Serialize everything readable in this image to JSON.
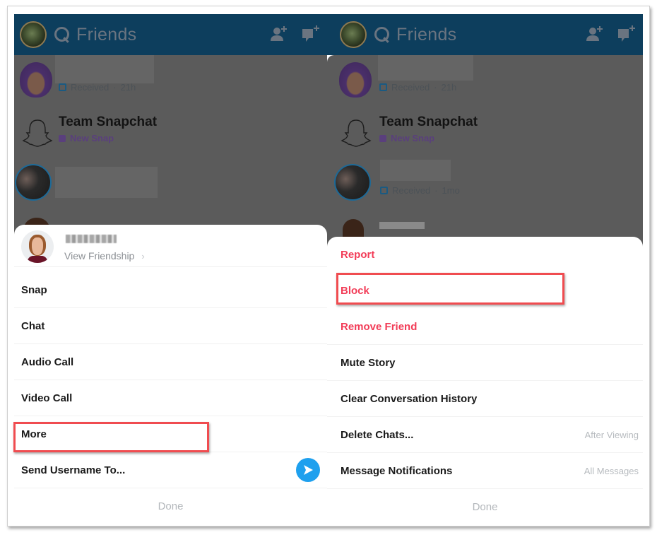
{
  "left_panel": {
    "header": {
      "title": "Friends",
      "icons": [
        "bitmoji-avatar",
        "search-icon",
        "add-friend-icon",
        "new-chat-icon"
      ]
    },
    "friends_list": [
      {
        "name": "",
        "status_icon": "chat-outline-icon",
        "status": "Received",
        "time": "21h"
      },
      {
        "name": "Team Snapchat",
        "status_icon": "snap-square-icon",
        "status": "New Snap"
      },
      {
        "name": "",
        "status_icon": "chat-outline-icon",
        "status": ""
      }
    ],
    "sheet": {
      "profile": {
        "name_blurred": true,
        "view_friendship": "View Friendship",
        "chevron": "›"
      },
      "items": [
        {
          "label": "Snap"
        },
        {
          "label": "Chat"
        },
        {
          "label": "Audio Call"
        },
        {
          "label": "Video Call"
        },
        {
          "label": "More",
          "highlighted": true
        },
        {
          "label": "Send Username To...",
          "icon": "send-arrow-icon"
        }
      ],
      "done_label": "Done"
    }
  },
  "right_panel": {
    "header": {
      "title": "Friends",
      "icons": [
        "bitmoji-avatar",
        "search-icon",
        "add-friend-icon",
        "new-chat-icon"
      ]
    },
    "friends_list": [
      {
        "name": "",
        "status_icon": "chat-outline-icon",
        "status": "Received",
        "time": "21h"
      },
      {
        "name": "Team Snapchat",
        "status_icon": "snap-square-icon",
        "status": "New Snap"
      },
      {
        "name": "",
        "status_icon": "chat-outline-icon",
        "status": "Received",
        "time": "1mo"
      },
      {
        "name": "",
        "blurred": true
      }
    ],
    "sheet": {
      "items": [
        {
          "label": "Report",
          "danger": true
        },
        {
          "label": "Block",
          "danger": true,
          "highlighted": true
        },
        {
          "label": "Remove Friend",
          "danger": true
        },
        {
          "label": "Mute Story"
        },
        {
          "label": "Clear Conversation History"
        },
        {
          "label": "Delete Chats...",
          "value": "After Viewing"
        },
        {
          "label": "Message Notifications",
          "value": "All Messages"
        }
      ],
      "done_label": "Done"
    }
  },
  "colors": {
    "header_bg": "#0d3e5d",
    "dim_overlay": "#5b5b5b",
    "danger_text": "#f23c57",
    "highlight_box": "#f04c50",
    "send_button": "#1ea0ee",
    "snap_purple": "#5a3f7d",
    "muted_text": "#b7bbbf"
  }
}
